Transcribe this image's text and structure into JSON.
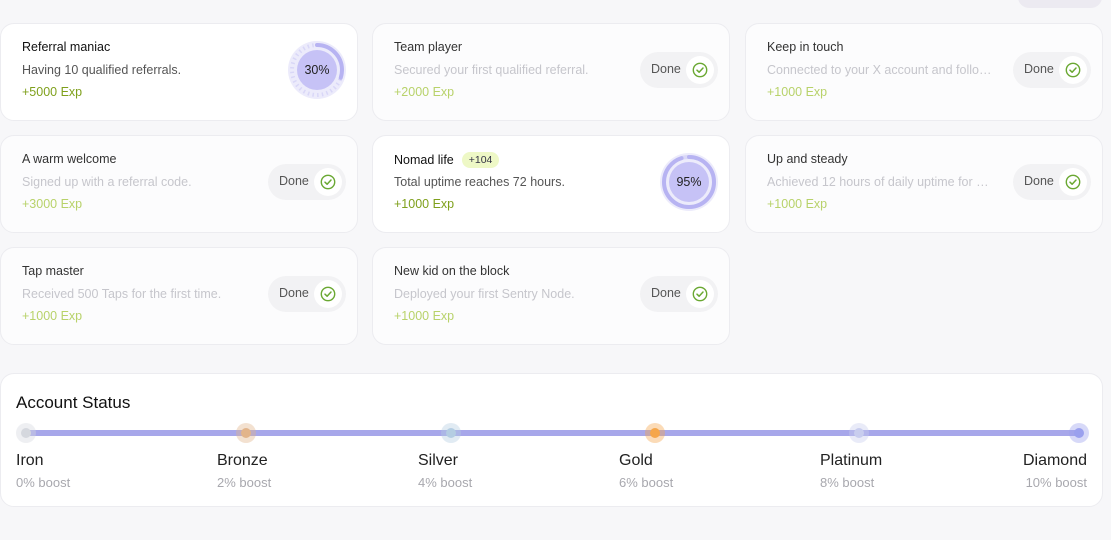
{
  "achievements": [
    {
      "title": "Referral maniac",
      "desc": "Having 10 qualified referrals.",
      "exp": "+5000 Exp",
      "state": "progress",
      "progress": "30%",
      "progress_value": 0.3
    },
    {
      "title": "Team player",
      "desc": "Secured your first qualified referral.",
      "exp": "+2000 Exp",
      "state": "done",
      "done_label": "Done"
    },
    {
      "title": "Keep in touch",
      "desc": "Connected to your X account and followed us.",
      "exp": "+1000 Exp",
      "state": "done",
      "done_label": "Done"
    },
    {
      "title": "A warm welcome",
      "desc": "Signed up with a referral code.",
      "exp": "+3000 Exp",
      "state": "done",
      "done_label": "Done"
    },
    {
      "title": "Nomad life",
      "chip": "+104",
      "desc": "Total uptime reaches 72 hours.",
      "exp": "+1000 Exp",
      "state": "progress",
      "progress": "95%",
      "progress_value": 0.95
    },
    {
      "title": "Up and steady",
      "desc": "Achieved 12 hours of daily uptime for a week.",
      "exp": "+1000 Exp",
      "state": "done",
      "done_label": "Done"
    },
    {
      "title": "Tap master",
      "desc": "Received 500 Taps for the first time.",
      "exp": "+1000 Exp",
      "state": "done",
      "done_label": "Done"
    },
    {
      "title": "New kid on the block",
      "desc": "Deployed your first Sentry Node.",
      "exp": "+1000 Exp",
      "state": "done",
      "done_label": "Done"
    }
  ],
  "account_status": {
    "title": "Account Status",
    "tiers": [
      {
        "name": "Iron",
        "boost": "0% boost",
        "color": "#d5d8de"
      },
      {
        "name": "Bronze",
        "boost": "2% boost",
        "color": "#e2b48a"
      },
      {
        "name": "Silver",
        "boost": "4% boost",
        "color": "#b4cde2"
      },
      {
        "name": "Gold",
        "boost": "6% boost",
        "color": "#f5a64a"
      },
      {
        "name": "Platinum",
        "boost": "8% boost",
        "color": "#c8cdee"
      },
      {
        "name": "Diamond",
        "boost": "10% boost",
        "color": "#9aa0ee"
      }
    ]
  },
  "colors": {
    "accent": "#a7a7ea",
    "exp": "#7fa01c",
    "check": "#6aa832",
    "ring": "#b7b3f2"
  }
}
